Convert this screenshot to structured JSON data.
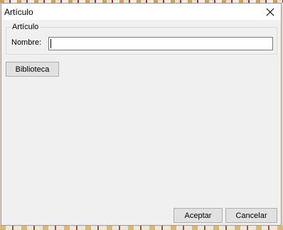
{
  "window": {
    "title": "Artículo",
    "close_icon": "close-icon"
  },
  "article_group": {
    "label": "Artículo",
    "name_label": "Nombre:",
    "name_value": "",
    "name_placeholder": ""
  },
  "buttons": {
    "library_label": "Biblioteca",
    "accept_label": "Aceptar",
    "cancel_label": "Cancelar"
  }
}
